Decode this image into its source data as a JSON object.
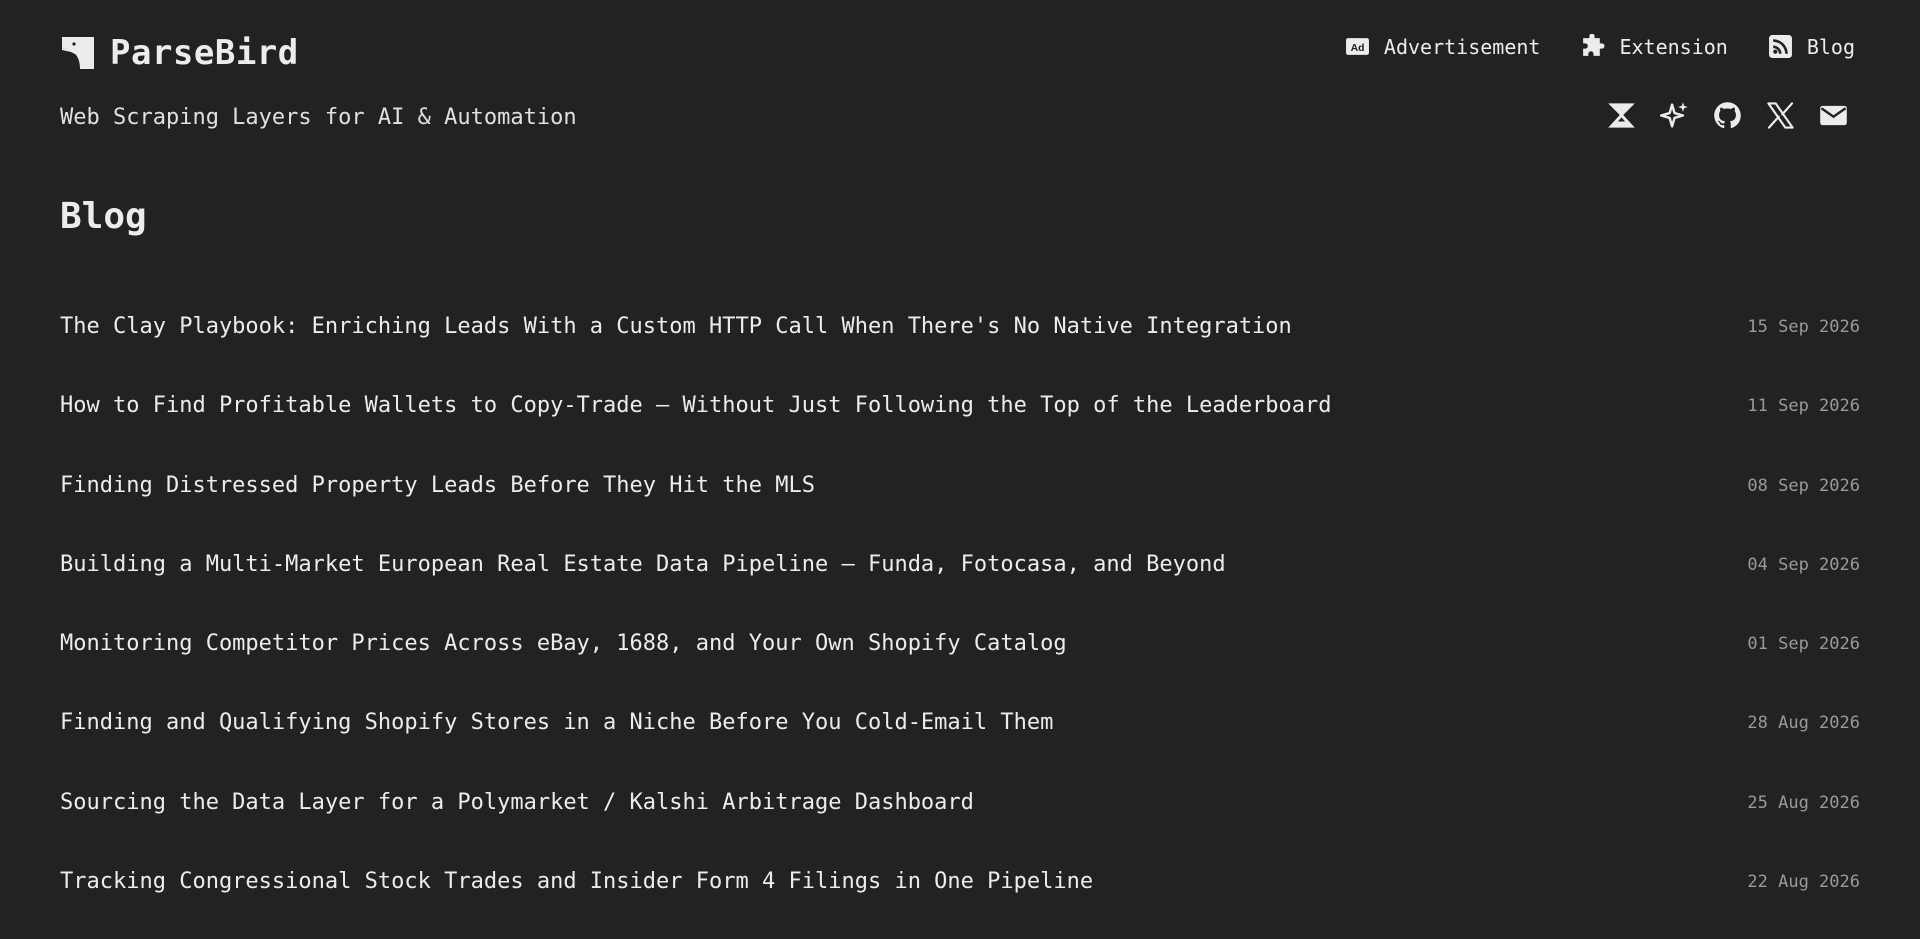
{
  "site": {
    "name": "ParseBird",
    "tagline": "Web Scraping Layers for AI & Automation"
  },
  "nav": [
    {
      "label": "Advertisement",
      "icon": "ad-icon"
    },
    {
      "label": "Extension",
      "icon": "puzzle-icon"
    },
    {
      "label": "Blog",
      "icon": "rss-icon"
    }
  ],
  "social": [
    {
      "icon": "apify-icon"
    },
    {
      "icon": "sparkle-icon"
    },
    {
      "icon": "github-icon"
    },
    {
      "icon": "x-icon"
    },
    {
      "icon": "mail-icon"
    }
  ],
  "section": {
    "title": "Blog"
  },
  "posts": [
    {
      "title": "The Clay Playbook: Enriching Leads With a Custom HTTP Call When There's No Native Integration",
      "date": "15 Sep 2026"
    },
    {
      "title": "How to Find Profitable Wallets to Copy-Trade — Without Just Following the Top of the Leaderboard",
      "date": "11 Sep 2026"
    },
    {
      "title": "Finding Distressed Property Leads Before They Hit the MLS",
      "date": "08 Sep 2026"
    },
    {
      "title": "Building a Multi-Market European Real Estate Data Pipeline — Funda, Fotocasa, and Beyond",
      "date": "04 Sep 2026"
    },
    {
      "title": "Monitoring Competitor Prices Across eBay, 1688, and Your Own Shopify Catalog",
      "date": "01 Sep 2026"
    },
    {
      "title": "Finding and Qualifying Shopify Stores in a Niche Before You Cold-Email Them",
      "date": "28 Aug 2026"
    },
    {
      "title": "Sourcing the Data Layer for a Polymarket / Kalshi Arbitrage Dashboard",
      "date": "25 Aug 2026"
    },
    {
      "title": "Tracking Congressional Stock Trades and Insider Form 4 Filings in One Pipeline",
      "date": "22 Aug 2026"
    }
  ],
  "colors": {
    "background": "#222222",
    "text": "#ececec",
    "muted": "#9a9a9a"
  }
}
